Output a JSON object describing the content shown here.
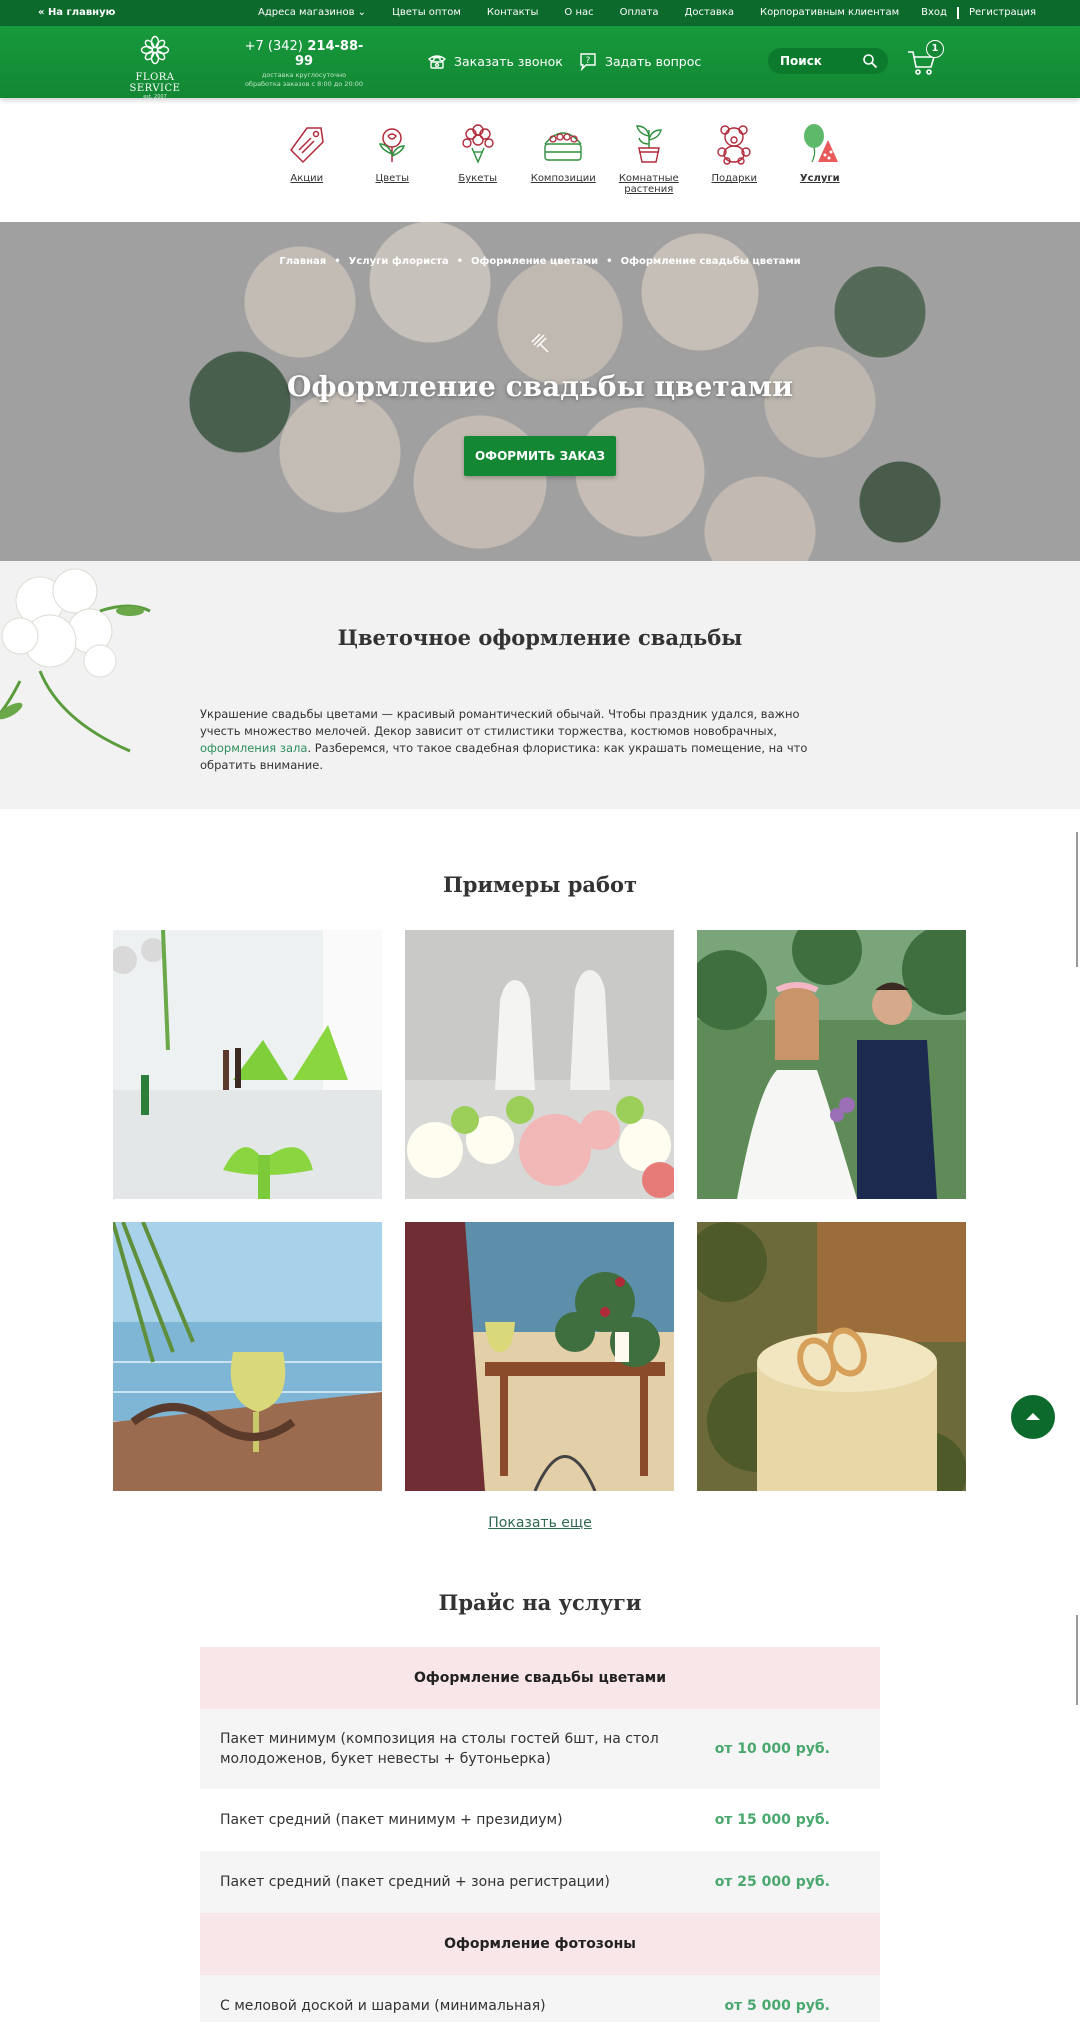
{
  "topbar": {
    "home": "« На главную",
    "nav": [
      "Адреса магазинов",
      "Цветы оптом",
      "Контакты",
      "О нас",
      "Оплата",
      "Доставка",
      "Корпоративным клиентам"
    ],
    "login": "Вход",
    "register": "Регистрация"
  },
  "header": {
    "logo_name": "FLORA SERVICE",
    "logo_est": "est. 2007",
    "phone_code": "+7 (342)",
    "phone_number": "214-88-99",
    "phone_sub1": "доставка круглосуточно",
    "phone_sub2": "обработка заказов с 8:00 до 20:00",
    "callback": "Заказать звонок",
    "question": "Задать вопрос",
    "search_placeholder": "Поиск",
    "cart_count": "1"
  },
  "categories": [
    {
      "label": "Акции",
      "icon": "tag-icon"
    },
    {
      "label": "Цветы",
      "icon": "rose-icon"
    },
    {
      "label": "Букеты",
      "icon": "bouquet-icon"
    },
    {
      "label": "Композиции",
      "icon": "basket-icon"
    },
    {
      "label": "Комнатные растения",
      "icon": "potted-plant-icon"
    },
    {
      "label": "Подарки",
      "icon": "teddy-bear-icon"
    },
    {
      "label": "Услуги",
      "icon": "balloon-icon"
    }
  ],
  "hero": {
    "breadcrumbs": [
      "Главная",
      "Услуги флориста",
      "Оформление цветами",
      "Оформление свадьбы цветами"
    ],
    "title": "Оформление свадьбы цветами",
    "order_button": "ОФОРМИТЬ ЗАКАЗ"
  },
  "intro": {
    "title": "Цветочное оформление свадьбы",
    "text_before": "Украшение свадьбы цветами — красивый романтический обычай. Чтобы праздник удался, важно учесть множество мелочей. Декор зависит от стилистики торжества, костюмов новобрачных, ",
    "link": "оформления зала",
    "text_after": ". Разберемся, что такое свадебная флористика: как украшать помещение, на что обратить внимание."
  },
  "gallery": {
    "title": "Примеры работ",
    "more": "Показать еще"
  },
  "price": {
    "title": "Прайс на услуги",
    "groups": [
      {
        "title": "Оформление свадьбы цветами",
        "rows": [
          {
            "desc": "Пакет минимум (композиция на столы гостей 6шт, на стол молодоженов, букет невесты + бутоньерка)",
            "cost": "от 10 000 руб."
          },
          {
            "desc": "Пакет средний (пакет минимум + президиум)",
            "cost": "от 15 000 руб."
          },
          {
            "desc": "Пакет средний (пакет средний + зона регистрации)",
            "cost": "от 25 000 руб."
          }
        ]
      },
      {
        "title": "Оформление фотозоны",
        "rows": [
          {
            "desc": "С меловой доской и шарами (минимальная)",
            "cost": "от 5 000 руб."
          }
        ]
      }
    ]
  },
  "colors": {
    "brand": "#138734",
    "brand_dark": "#0d6a2d",
    "price": "#4aa86f",
    "price_header": "#f8e6e8"
  }
}
